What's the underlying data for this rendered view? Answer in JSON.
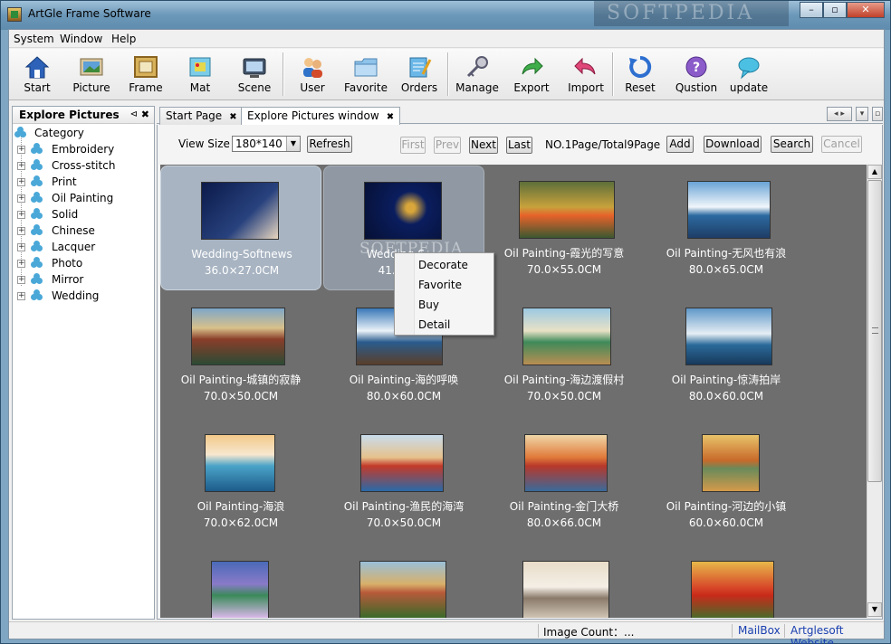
{
  "window": {
    "title": "ArtGle Frame Software",
    "watermark": "SOFTPEDIA"
  },
  "menu": [
    "System",
    "Window",
    "Help"
  ],
  "toolbar": [
    {
      "label": "Start",
      "icon": "home-icon"
    },
    {
      "label": "Picture",
      "icon": "picture-icon"
    },
    {
      "label": "Frame",
      "icon": "frame-icon"
    },
    {
      "label": "Mat",
      "icon": "mat-icon"
    },
    {
      "label": "Scene",
      "icon": "scene-icon"
    },
    {
      "label": "User",
      "icon": "user-icon"
    },
    {
      "label": "Favorite",
      "icon": "folder-icon"
    },
    {
      "label": "Orders",
      "icon": "orders-icon"
    },
    {
      "label": "Manage",
      "icon": "key-icon"
    },
    {
      "label": "Export",
      "icon": "export-arrow-icon"
    },
    {
      "label": "Import",
      "icon": "import-arrow-icon"
    },
    {
      "label": "Reset",
      "icon": "reset-icon"
    },
    {
      "label": "Qustion",
      "icon": "question-icon"
    },
    {
      "label": "update",
      "icon": "chat-bubble-icon"
    }
  ],
  "left_panel": {
    "title": "Explore Pictures",
    "pin": "⊲",
    "close": "✖",
    "root": "Category",
    "categories": [
      "Embroidery",
      "Cross-stitch",
      "Print",
      "Oil Painting",
      "Solid",
      "Chinese",
      "Lacquer",
      "Photo",
      "Mirror",
      "Wedding"
    ]
  },
  "tabs": [
    {
      "label": "Start Page",
      "close": "✖"
    },
    {
      "label": "Explore Pictures window",
      "close": "✖"
    }
  ],
  "controls": {
    "view_size_label": "View Size",
    "view_size_value": "180*140",
    "refresh": "Refresh",
    "first": "First",
    "prev": "Prev",
    "next": "Next",
    "last": "Last",
    "page_info": "NO.1Page/Total9Page",
    "add": "Add",
    "download": "Download",
    "search": "Search",
    "cancel": "Cancel"
  },
  "pictures": [
    {
      "name": "Wedding-Softnews",
      "size": "36.0×27.0CM"
    },
    {
      "name": "Wedding-S",
      "size": "41.0"
    },
    {
      "name": "Oil Painting-霞光的写意",
      "size": "70.0×55.0CM"
    },
    {
      "name": "Oil Painting-无风也有浪",
      "size": "80.0×65.0CM"
    },
    {
      "name": "Oil Painting-城镇的寂静",
      "size": "70.0×50.0CM"
    },
    {
      "name": "Oil Painting-海的呼唤",
      "size": "80.0×60.0CM"
    },
    {
      "name": "Oil Painting-海边渡假村",
      "size": "70.0×50.0CM"
    },
    {
      "name": "Oil Painting-惊涛拍岸",
      "size": "80.0×60.0CM"
    },
    {
      "name": "Oil Painting-海浪",
      "size": "70.0×62.0CM"
    },
    {
      "name": "Oil Painting-渔民的海湾",
      "size": "70.0×50.0CM"
    },
    {
      "name": "Oil Painting-金门大桥",
      "size": "80.0×66.0CM"
    },
    {
      "name": "Oil Painting-河边的小镇",
      "size": "60.0×60.0CM"
    },
    {
      "name": "",
      "size": ""
    },
    {
      "name": "",
      "size": ""
    },
    {
      "name": "",
      "size": ""
    },
    {
      "name": "",
      "size": ""
    }
  ],
  "context_menu": [
    "Decorate",
    "Favorite",
    "Buy",
    "Detail"
  ],
  "status": {
    "image_count": "Image Count：...",
    "mailbox": "MailBox",
    "website": "Artglesoft Website"
  },
  "colors": {
    "grid_bg": "#6e6e6e",
    "selected_cell": "#a8b4c2",
    "link": "#1a3fb0"
  }
}
